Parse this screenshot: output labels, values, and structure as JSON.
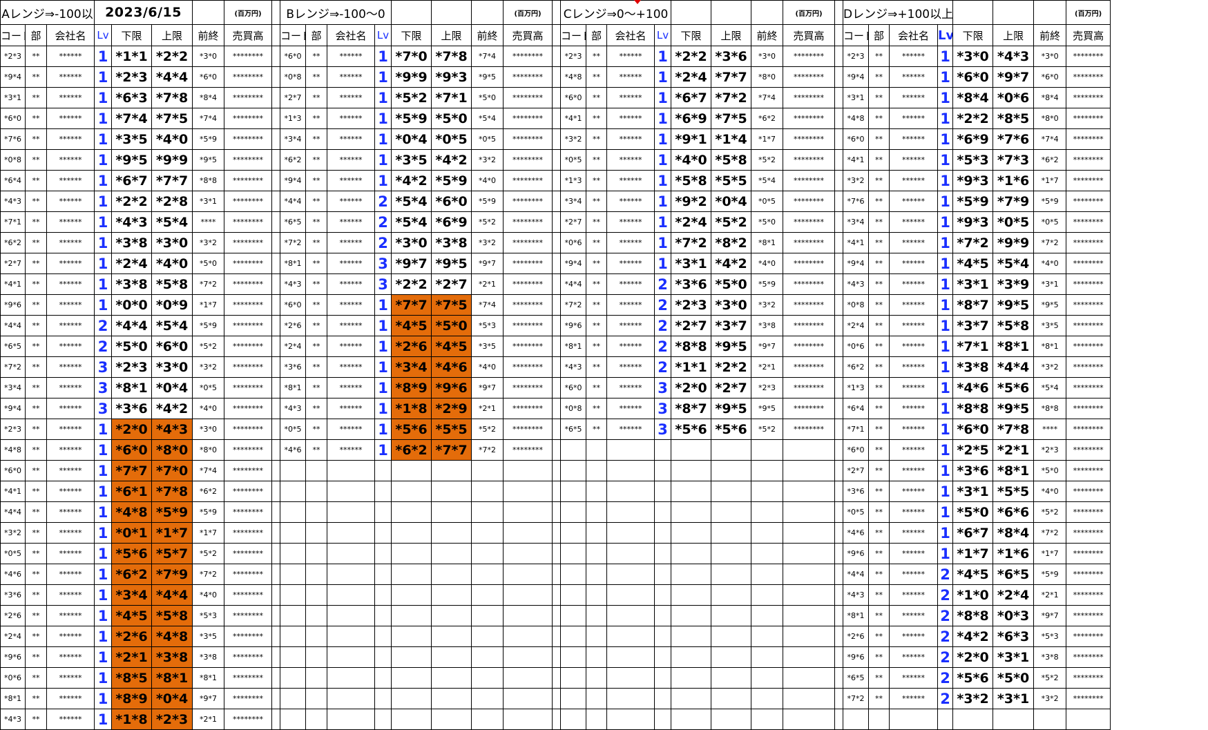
{
  "date": "2023/6/15",
  "unit_label": "(百万円)",
  "colors": {
    "highlight": "#e46c0a",
    "lv_blue": "#1a2fff"
  },
  "headers": [
    "コード",
    "部",
    "会社名",
    "Lv",
    "下限",
    "上限",
    "前終",
    "売買高"
  ],
  "blocks": [
    {
      "title": "Aレンジ⇒-100以",
      "rows": [
        [
          "*2*3",
          "**",
          "******",
          "1",
          "*1*1",
          "*2*2",
          "*3*0",
          "********",
          0
        ],
        [
          "*9*4",
          "**",
          "******",
          "1",
          "*2*3",
          "*4*4",
          "*6*0",
          "********",
          0
        ],
        [
          "*3*1",
          "**",
          "******",
          "1",
          "*6*3",
          "*7*8",
          "*8*4",
          "********",
          0
        ],
        [
          "*6*0",
          "**",
          "******",
          "1",
          "*7*4",
          "*7*5",
          "*7*4",
          "********",
          0
        ],
        [
          "*7*6",
          "**",
          "******",
          "1",
          "*3*5",
          "*4*0",
          "*5*9",
          "********",
          0
        ],
        [
          "*0*8",
          "**",
          "******",
          "1",
          "*9*5",
          "*9*9",
          "*9*5",
          "********",
          0
        ],
        [
          "*6*4",
          "**",
          "******",
          "1",
          "*6*7",
          "*7*7",
          "*8*8",
          "********",
          0
        ],
        [
          "*4*3",
          "**",
          "******",
          "1",
          "*2*2",
          "*2*8",
          "*3*1",
          "********",
          0
        ],
        [
          "*7*1",
          "**",
          "******",
          "1",
          "*4*3",
          "*5*4",
          "****",
          "********",
          0
        ],
        [
          "*6*2",
          "**",
          "******",
          "1",
          "*3*8",
          "*3*0",
          "*3*2",
          "********",
          0
        ],
        [
          "*2*7",
          "**",
          "******",
          "1",
          "*2*4",
          "*4*0",
          "*5*0",
          "********",
          0
        ],
        [
          "*4*1",
          "**",
          "******",
          "1",
          "*3*8",
          "*5*8",
          "*7*2",
          "********",
          0
        ],
        [
          "*9*6",
          "**",
          "******",
          "1",
          "*0*0",
          "*0*9",
          "*1*7",
          "********",
          0
        ],
        [
          "*4*4",
          "**",
          "******",
          "2",
          "*4*4",
          "*5*4",
          "*5*9",
          "********",
          0
        ],
        [
          "*6*5",
          "**",
          "******",
          "2",
          "*5*0",
          "*6*0",
          "*5*2",
          "********",
          0
        ],
        [
          "*7*2",
          "**",
          "******",
          "3",
          "*2*3",
          "*3*0",
          "*3*2",
          "********",
          0
        ],
        [
          "*3*4",
          "**",
          "******",
          "3",
          "*8*1",
          "*0*4",
          "*0*5",
          "********",
          0
        ],
        [
          "*9*4",
          "**",
          "******",
          "3",
          "*3*6",
          "*4*2",
          "*4*0",
          "********",
          0
        ],
        [
          "*2*3",
          "**",
          "******",
          "1",
          "*2*0",
          "*4*3",
          "*3*0",
          "********",
          1
        ],
        [
          "*4*8",
          "**",
          "******",
          "1",
          "*6*0",
          "*8*0",
          "*8*0",
          "********",
          1
        ],
        [
          "*6*0",
          "**",
          "******",
          "1",
          "*7*7",
          "*7*0",
          "*7*4",
          "********",
          1
        ],
        [
          "*4*1",
          "**",
          "******",
          "1",
          "*6*1",
          "*7*8",
          "*6*2",
          "********",
          1
        ],
        [
          "*4*4",
          "**",
          "******",
          "1",
          "*4*8",
          "*5*9",
          "*5*9",
          "********",
          1
        ],
        [
          "*3*2",
          "**",
          "******",
          "1",
          "*0*1",
          "*1*7",
          "*1*7",
          "********",
          1
        ],
        [
          "*0*5",
          "**",
          "******",
          "1",
          "*5*6",
          "*5*7",
          "*5*2",
          "********",
          1
        ],
        [
          "*4*6",
          "**",
          "******",
          "1",
          "*6*2",
          "*7*9",
          "*7*2",
          "********",
          1
        ],
        [
          "*3*6",
          "**",
          "******",
          "1",
          "*3*4",
          "*4*4",
          "*4*0",
          "********",
          1
        ],
        [
          "*2*6",
          "**",
          "******",
          "1",
          "*4*5",
          "*5*8",
          "*5*3",
          "********",
          1
        ],
        [
          "*2*4",
          "**",
          "******",
          "1",
          "*2*6",
          "*4*8",
          "*3*5",
          "********",
          1
        ],
        [
          "*9*6",
          "**",
          "******",
          "1",
          "*2*1",
          "*3*8",
          "*3*8",
          "********",
          1
        ],
        [
          "*0*6",
          "**",
          "******",
          "1",
          "*8*5",
          "*8*1",
          "*8*1",
          "********",
          1
        ],
        [
          "*8*1",
          "**",
          "******",
          "1",
          "*8*9",
          "*0*4",
          "*9*7",
          "********",
          1
        ],
        [
          "*4*3",
          "**",
          "******",
          "1",
          "*1*8",
          "*2*3",
          "*2*1",
          "********",
          1
        ]
      ]
    },
    {
      "title": "Bレンジ⇒-100～0",
      "rows": [
        [
          "*6*0",
          "**",
          "******",
          "1",
          "*7*0",
          "*7*8",
          "*7*4",
          "********",
          0
        ],
        [
          "*0*8",
          "**",
          "******",
          "1",
          "*9*9",
          "*9*3",
          "*9*5",
          "********",
          0
        ],
        [
          "*2*7",
          "**",
          "******",
          "1",
          "*5*2",
          "*7*1",
          "*5*0",
          "********",
          0
        ],
        [
          "*1*3",
          "**",
          "******",
          "1",
          "*5*9",
          "*5*0",
          "*5*4",
          "********",
          0
        ],
        [
          "*3*4",
          "**",
          "******",
          "1",
          "*0*4",
          "*0*5",
          "*0*5",
          "********",
          0
        ],
        [
          "*6*2",
          "**",
          "******",
          "1",
          "*3*5",
          "*4*2",
          "*3*2",
          "********",
          0
        ],
        [
          "*9*4",
          "**",
          "******",
          "1",
          "*4*2",
          "*5*9",
          "*4*0",
          "********",
          0
        ],
        [
          "*4*4",
          "**",
          "******",
          "2",
          "*5*4",
          "*6*0",
          "*5*9",
          "********",
          0
        ],
        [
          "*6*5",
          "**",
          "******",
          "2",
          "*5*4",
          "*6*9",
          "*5*2",
          "********",
          0
        ],
        [
          "*7*2",
          "**",
          "******",
          "2",
          "*3*0",
          "*3*8",
          "*3*2",
          "********",
          0
        ],
        [
          "*8*1",
          "**",
          "******",
          "3",
          "*9*7",
          "*9*5",
          "*9*7",
          "********",
          0
        ],
        [
          "*4*3",
          "**",
          "******",
          "3",
          "*2*2",
          "*2*7",
          "*2*1",
          "********",
          0
        ],
        [
          "*6*0",
          "**",
          "******",
          "1",
          "*7*7",
          "*7*5",
          "*7*4",
          "********",
          1
        ],
        [
          "*2*6",
          "**",
          "******",
          "1",
          "*4*5",
          "*5*0",
          "*5*3",
          "********",
          1
        ],
        [
          "*2*4",
          "**",
          "******",
          "1",
          "*2*6",
          "*4*5",
          "*3*5",
          "********",
          1
        ],
        [
          "*3*6",
          "**",
          "******",
          "1",
          "*3*4",
          "*4*6",
          "*4*0",
          "********",
          1
        ],
        [
          "*8*1",
          "**",
          "******",
          "1",
          "*8*9",
          "*9*6",
          "*9*7",
          "********",
          1
        ],
        [
          "*4*3",
          "**",
          "******",
          "1",
          "*1*8",
          "*2*9",
          "*2*1",
          "********",
          1
        ],
        [
          "*0*5",
          "**",
          "******",
          "1",
          "*5*6",
          "*5*5",
          "*5*2",
          "********",
          1
        ],
        [
          "*4*6",
          "**",
          "******",
          "1",
          "*6*2",
          "*7*7",
          "*7*2",
          "********",
          1
        ]
      ]
    },
    {
      "title": "Cレンジ⇒0～+100",
      "rows": [
        [
          "*2*3",
          "**",
          "******",
          "1",
          "*2*2",
          "*3*6",
          "*3*0",
          "********",
          0
        ],
        [
          "*4*8",
          "**",
          "******",
          "1",
          "*2*4",
          "*7*7",
          "*8*0",
          "********",
          0
        ],
        [
          "*6*0",
          "**",
          "******",
          "1",
          "*6*7",
          "*7*2",
          "*7*4",
          "********",
          0
        ],
        [
          "*4*1",
          "**",
          "******",
          "1",
          "*6*9",
          "*7*5",
          "*6*2",
          "********",
          0
        ],
        [
          "*3*2",
          "**",
          "******",
          "1",
          "*9*1",
          "*1*4",
          "*1*7",
          "********",
          0
        ],
        [
          "*0*5",
          "**",
          "******",
          "1",
          "*4*0",
          "*5*8",
          "*5*2",
          "********",
          0
        ],
        [
          "*1*3",
          "**",
          "******",
          "1",
          "*5*8",
          "*5*5",
          "*5*4",
          "********",
          0
        ],
        [
          "*3*4",
          "**",
          "******",
          "1",
          "*9*2",
          "*0*4",
          "*0*5",
          "********",
          0
        ],
        [
          "*2*7",
          "**",
          "******",
          "1",
          "*2*4",
          "*5*2",
          "*5*0",
          "********",
          0
        ],
        [
          "*0*6",
          "**",
          "******",
          "1",
          "*7*2",
          "*8*2",
          "*8*1",
          "********",
          0
        ],
        [
          "*9*4",
          "**",
          "******",
          "1",
          "*3*1",
          "*4*2",
          "*4*0",
          "********",
          0
        ],
        [
          "*4*4",
          "**",
          "******",
          "2",
          "*3*6",
          "*5*0",
          "*5*9",
          "********",
          0
        ],
        [
          "*7*2",
          "**",
          "******",
          "2",
          "*2*3",
          "*3*0",
          "*3*2",
          "********",
          0
        ],
        [
          "*9*6",
          "**",
          "******",
          "2",
          "*2*7",
          "*3*7",
          "*3*8",
          "********",
          0
        ],
        [
          "*8*1",
          "**",
          "******",
          "2",
          "*8*8",
          "*9*5",
          "*9*7",
          "********",
          0
        ],
        [
          "*4*3",
          "**",
          "******",
          "2",
          "*1*1",
          "*2*2",
          "*2*1",
          "********",
          0
        ],
        [
          "*6*0",
          "**",
          "******",
          "3",
          "*2*0",
          "*2*7",
          "*2*3",
          "********",
          0
        ],
        [
          "*0*8",
          "**",
          "******",
          "3",
          "*8*7",
          "*9*5",
          "*9*5",
          "********",
          0
        ],
        [
          "*6*5",
          "**",
          "******",
          "3",
          "*5*6",
          "*5*6",
          "*5*2",
          "********",
          0
        ]
      ]
    },
    {
      "title": "Dレンジ⇒+100以上",
      "rows": [
        [
          "*2*3",
          "**",
          "******",
          "1",
          "*3*0",
          "*4*3",
          "*3*0",
          "********",
          0
        ],
        [
          "*9*4",
          "**",
          "******",
          "1",
          "*6*0",
          "*9*7",
          "*6*0",
          "********",
          0
        ],
        [
          "*3*1",
          "**",
          "******",
          "1",
          "*8*4",
          "*0*6",
          "*8*4",
          "********",
          0
        ],
        [
          "*4*8",
          "**",
          "******",
          "1",
          "*2*2",
          "*8*5",
          "*8*0",
          "********",
          0
        ],
        [
          "*6*0",
          "**",
          "******",
          "1",
          "*6*9",
          "*7*6",
          "*7*4",
          "********",
          0
        ],
        [
          "*4*1",
          "**",
          "******",
          "1",
          "*5*3",
          "*7*3",
          "*6*2",
          "********",
          0
        ],
        [
          "*3*2",
          "**",
          "******",
          "1",
          "*9*3",
          "*1*6",
          "*1*7",
          "********",
          0
        ],
        [
          "*7*6",
          "**",
          "******",
          "1",
          "*5*9",
          "*7*9",
          "*5*9",
          "********",
          0
        ],
        [
          "*3*4",
          "**",
          "******",
          "1",
          "*9*3",
          "*0*5",
          "*0*5",
          "********",
          0
        ],
        [
          "*4*1",
          "**",
          "******",
          "1",
          "*7*2",
          "*9*9",
          "*7*2",
          "********",
          0
        ],
        [
          "*9*4",
          "**",
          "******",
          "1",
          "*4*5",
          "*5*4",
          "*4*0",
          "********",
          0
        ],
        [
          "*4*3",
          "**",
          "******",
          "1",
          "*3*1",
          "*3*9",
          "*3*1",
          "********",
          0
        ],
        [
          "*0*8",
          "**",
          "******",
          "1",
          "*8*7",
          "*9*5",
          "*9*5",
          "********",
          0
        ],
        [
          "*2*4",
          "**",
          "******",
          "1",
          "*3*7",
          "*5*8",
          "*3*5",
          "********",
          0
        ],
        [
          "*0*6",
          "**",
          "******",
          "1",
          "*7*1",
          "*8*1",
          "*8*1",
          "********",
          0
        ],
        [
          "*6*2",
          "**",
          "******",
          "1",
          "*3*8",
          "*4*4",
          "*3*2",
          "********",
          0
        ],
        [
          "*1*3",
          "**",
          "******",
          "1",
          "*4*6",
          "*5*6",
          "*5*4",
          "********",
          0
        ],
        [
          "*6*4",
          "**",
          "******",
          "1",
          "*8*8",
          "*9*5",
          "*8*8",
          "********",
          0
        ],
        [
          "*7*1",
          "**",
          "******",
          "1",
          "*6*0",
          "*7*8",
          "****",
          "********",
          0
        ],
        [
          "*6*0",
          "**",
          "******",
          "1",
          "*2*5",
          "*2*1",
          "*2*3",
          "********",
          0
        ],
        [
          "*2*7",
          "**",
          "******",
          "1",
          "*3*6",
          "*8*1",
          "*5*0",
          "********",
          0
        ],
        [
          "*3*6",
          "**",
          "******",
          "1",
          "*3*1",
          "*5*5",
          "*4*0",
          "********",
          0
        ],
        [
          "*0*5",
          "**",
          "******",
          "1",
          "*5*0",
          "*6*6",
          "*5*2",
          "********",
          0
        ],
        [
          "*4*6",
          "**",
          "******",
          "1",
          "*6*7",
          "*8*4",
          "*7*2",
          "********",
          0
        ],
        [
          "*9*6",
          "**",
          "******",
          "1",
          "*1*7",
          "*1*6",
          "*1*7",
          "********",
          0
        ],
        [
          "*4*4",
          "**",
          "******",
          "2",
          "*4*5",
          "*6*5",
          "*5*9",
          "********",
          0
        ],
        [
          "*4*3",
          "**",
          "******",
          "2",
          "*1*0",
          "*2*4",
          "*2*1",
          "********",
          0
        ],
        [
          "*8*1",
          "**",
          "******",
          "2",
          "*8*8",
          "*0*3",
          "*9*7",
          "********",
          0
        ],
        [
          "*2*6",
          "**",
          "******",
          "2",
          "*4*2",
          "*6*3",
          "*5*3",
          "********",
          0
        ],
        [
          "*9*6",
          "**",
          "******",
          "2",
          "*2*0",
          "*3*1",
          "*3*8",
          "********",
          0
        ],
        [
          "*6*5",
          "**",
          "******",
          "2",
          "*5*6",
          "*5*0",
          "*5*2",
          "********",
          0
        ],
        [
          "*7*2",
          "**",
          "******",
          "2",
          "*3*2",
          "*3*1",
          "*3*2",
          "********",
          0
        ]
      ]
    }
  ]
}
